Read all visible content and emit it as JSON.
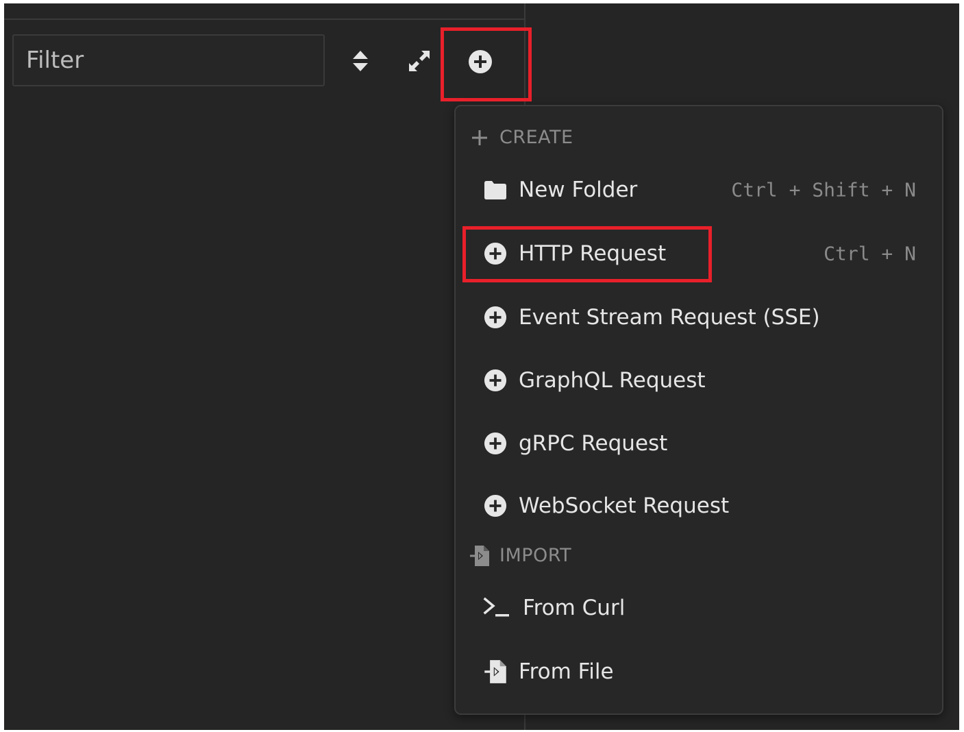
{
  "toolbar": {
    "filter_placeholder": "Filter",
    "sort_icon": "sort-up-down-icon",
    "expand_icon": "expand-arrows-icon",
    "add_icon": "plus-circle-icon"
  },
  "dropdown": {
    "create_section": {
      "label": "CREATE",
      "icon": "plus-icon"
    },
    "items": [
      {
        "label": "New Folder",
        "shortcut": "Ctrl + Shift + N",
        "icon": "folder-icon"
      },
      {
        "label": "HTTP Request",
        "shortcut": "Ctrl + N",
        "icon": "plus-circle-icon"
      },
      {
        "label": "Event Stream Request (SSE)",
        "shortcut": "",
        "icon": "plus-circle-icon"
      },
      {
        "label": "GraphQL Request",
        "shortcut": "",
        "icon": "plus-circle-icon"
      },
      {
        "label": "gRPC Request",
        "shortcut": "",
        "icon": "plus-circle-icon"
      },
      {
        "label": "WebSocket Request",
        "shortcut": "",
        "icon": "plus-circle-icon"
      }
    ],
    "import_section": {
      "label": "IMPORT",
      "icon": "file-import-icon"
    },
    "import_items": [
      {
        "label": "From Curl",
        "icon": "terminal-icon"
      },
      {
        "label": "From File",
        "icon": "file-import-icon"
      }
    ]
  },
  "colors": {
    "background": "#252525",
    "menu_background": "#272727",
    "highlight": "#e8202a",
    "text": "#e6e6e6",
    "muted": "#8c8c8c"
  }
}
